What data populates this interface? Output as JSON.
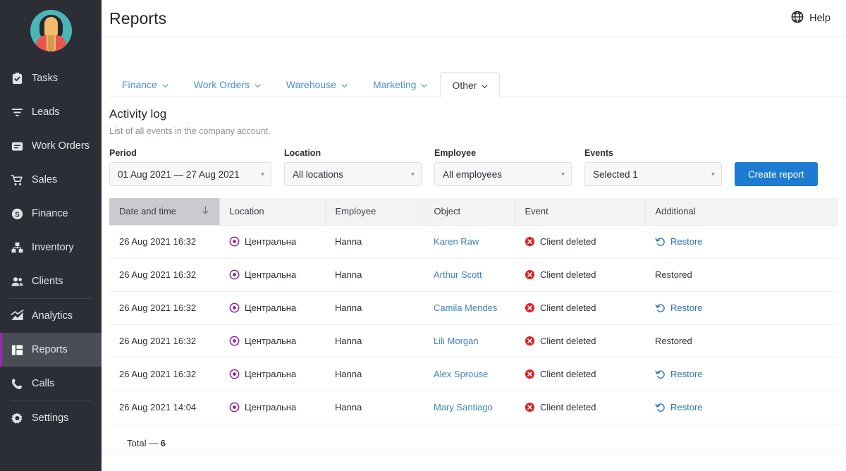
{
  "sidebar": {
    "avatar_name": "user-avatar",
    "items": [
      {
        "label": "Tasks",
        "icon": "clipboard-check-icon",
        "active": false,
        "sep_after": false
      },
      {
        "label": "Leads",
        "icon": "funnel-icon",
        "active": false,
        "sep_after": false
      },
      {
        "label": "Work Orders",
        "icon": "document-lines-icon",
        "active": false,
        "sep_after": false
      },
      {
        "label": "Sales",
        "icon": "shopping-cart-icon",
        "active": false,
        "sep_after": false
      },
      {
        "label": "Finance",
        "icon": "dollar-circle-icon",
        "active": false,
        "sep_after": false
      },
      {
        "label": "Inventory",
        "icon": "boxes-icon",
        "active": false,
        "sep_after": false
      },
      {
        "label": "Clients",
        "icon": "people-icon",
        "active": false,
        "sep_after": true
      },
      {
        "label": "Analytics",
        "icon": "mountain-chart-icon",
        "active": false,
        "sep_after": false
      },
      {
        "label": "Reports",
        "icon": "grid-report-icon",
        "active": true,
        "sep_after": false
      },
      {
        "label": "Calls",
        "icon": "phone-icon",
        "active": false,
        "sep_after": true
      },
      {
        "label": "Settings",
        "icon": "gear-icon",
        "active": false,
        "sep_after": false
      }
    ]
  },
  "header": {
    "title": "Reports",
    "help_label": "Help",
    "help_icon": "globe-help-icon"
  },
  "tabs": [
    {
      "label": "Finance",
      "active": false
    },
    {
      "label": "Work Orders",
      "active": false
    },
    {
      "label": "Warehouse",
      "active": false
    },
    {
      "label": "Marketing",
      "active": false
    },
    {
      "label": "Other",
      "active": true
    }
  ],
  "section": {
    "title": "Activity log",
    "subtitle": "List of all events in the company account."
  },
  "filters": {
    "period": {
      "label": "Period",
      "value": "01 Aug 2021 — 27 Aug 2021"
    },
    "location": {
      "label": "Location",
      "value": "All locations"
    },
    "employee": {
      "label": "Employee",
      "value": "All employees"
    },
    "events": {
      "label": "Events",
      "value": "Selected 1"
    },
    "create_button": "Create report"
  },
  "table": {
    "columns": [
      {
        "label": "Date and time",
        "sorted": true,
        "sort_dir": "desc"
      },
      {
        "label": "Location",
        "sorted": false
      },
      {
        "label": "Employee",
        "sorted": false
      },
      {
        "label": "Object",
        "sorted": false
      },
      {
        "label": "Event",
        "sorted": false
      },
      {
        "label": "Additional",
        "sorted": false
      }
    ],
    "rows": [
      {
        "datetime": "26 Aug 2021 16:32",
        "location": "Центральна",
        "employee": "Hanna",
        "object": "Karen Raw",
        "event": "Client deleted",
        "additional": "Restore",
        "additional_link": true
      },
      {
        "datetime": "26 Aug 2021 16:32",
        "location": "Центральна",
        "employee": "Hanna",
        "object": "Arthur Scott",
        "event": "Client deleted",
        "additional": "Restored",
        "additional_link": false
      },
      {
        "datetime": "26 Aug 2021 16:32",
        "location": "Центральна",
        "employee": "Hanna",
        "object": "Camila Mendes",
        "event": "Client deleted",
        "additional": "Restore",
        "additional_link": true
      },
      {
        "datetime": "26 Aug 2021 16:32",
        "location": "Центральна",
        "employee": "Hanna",
        "object": "Lili Morgan",
        "event": "Client deleted",
        "additional": "Restored",
        "additional_link": false
      },
      {
        "datetime": "26 Aug 2021 16:32",
        "location": "Центральна",
        "employee": "Hanna",
        "object": "Alex Sprouse",
        "event": "Client deleted",
        "additional": "Restore",
        "additional_link": true
      },
      {
        "datetime": "26 Aug 2021 14:04",
        "location": "Центральна",
        "employee": "Hanna",
        "object": "Mary Santiago",
        "event": "Client deleted",
        "additional": "Restore",
        "additional_link": true
      }
    ],
    "total_label": "Total —",
    "total_value": "6",
    "icons": {
      "location": "location-target-icon",
      "event": "delete-error-icon",
      "restore": "undo-restore-icon",
      "sort_desc": "arrow-down-icon"
    }
  },
  "colors": {
    "sidebar_bg": "#2b2e35",
    "sidebar_active_bg": "#4a4d55",
    "sidebar_active_accent": "#9c27b0",
    "primary_button": "#1d7cd1",
    "link": "#3d83c4",
    "tab_link": "#4a90d9",
    "location_icon": "#8e1fa8",
    "event_icon": "#e02020",
    "restore_icon": "#2b72bb",
    "table_header_bg": "#f2f3f4",
    "table_header_sorted_bg": "#c9cbcf"
  }
}
